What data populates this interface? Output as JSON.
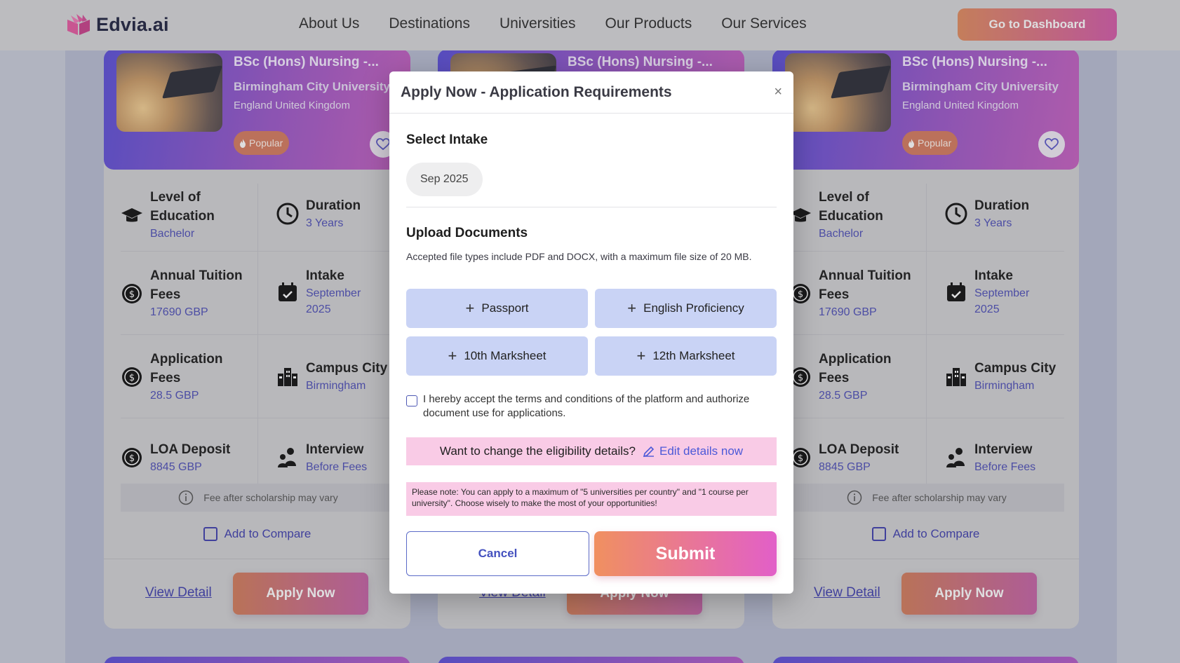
{
  "header": {
    "brand": "Edvia.ai",
    "nav": [
      "About Us",
      "Destinations",
      "Universities",
      "Our Products",
      "Our Services"
    ],
    "dashboard_button": "Go to Dashboard"
  },
  "card": {
    "title": "BSc (Hons) Nursing -...",
    "university": "Birmingham City University",
    "location": "England United Kingdom",
    "badge": "Popular",
    "fields": {
      "level_label_1": "Level of",
      "level_label_2": "Education",
      "level_value": "Bachelor",
      "duration_label": "Duration",
      "duration_value": "3 Years",
      "tuition_label_1": "Annual Tuition",
      "tuition_label_2": "Fees",
      "tuition_value": "17690 GBP",
      "intake_label": "Intake",
      "intake_value_1": "September",
      "intake_value_2": "2025",
      "appfee_label_1": "Application",
      "appfee_label_2": "Fees",
      "appfee_value": "28.5 GBP",
      "campus_label": "Campus City",
      "campus_value": "Birmingham",
      "loa_label": "LOA Deposit",
      "loa_value": "8845 GBP",
      "interview_label": "Interview",
      "interview_value": "Before Fees"
    },
    "scholarship_note": "Fee after scholarship may vary",
    "compare_label": "Add to Compare",
    "view_detail": "View Detail",
    "apply_now": "Apply Now",
    "middle_view_detail": "View Detail",
    "middle_apply_now": "Apply Now"
  },
  "modal": {
    "title": "Apply Now - Application Requirements",
    "close": "×",
    "select_intake_title": "Select Intake",
    "intake_option": "Sep 2025",
    "upload_title": "Upload Documents",
    "upload_help": "Accepted file types include PDF and DOCX, with a maximum file size of 20 MB.",
    "documents": [
      "Passport",
      "English Proficiency",
      "10th Marksheet",
      "12th Marksheet"
    ],
    "terms": "I hereby accept the terms and conditions of the platform and authorize document use for applications.",
    "eligibility_question": "Want to change the eligibility details?",
    "edit_link": "Edit details now",
    "note": "Please note: You can apply to a maximum of \"5 universities per country\" and \"1 course per university\". Choose wisely to make the most of your opportunities!",
    "cancel": "Cancel",
    "submit": "Submit"
  },
  "colors": {
    "accent_gradient_start": "#e08a5e",
    "accent_gradient_end": "#d35aa8",
    "card_header_start": "#5b4fd8",
    "link_blue": "#4c59d8",
    "pink_note": "#f9cbe6",
    "doc_button": "#c9d3f5"
  }
}
